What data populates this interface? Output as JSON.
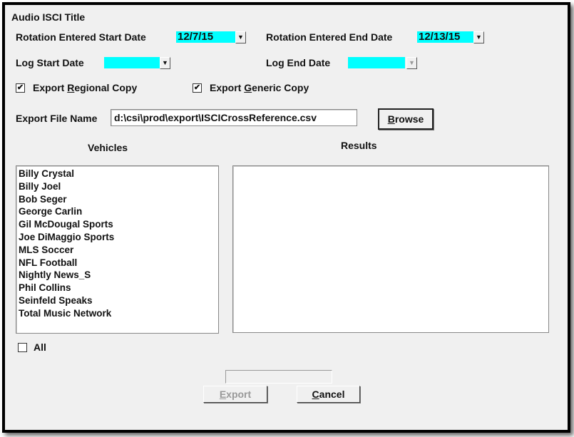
{
  "title": "Audio ISCI Title",
  "rotation_start": {
    "label": "Rotation Entered Start Date",
    "value": "12/7/15"
  },
  "rotation_end": {
    "label": "Rotation Entered End Date",
    "value": "12/13/15"
  },
  "log_start": {
    "label": "Log Start Date",
    "value": ""
  },
  "log_end": {
    "label": "Log End Date",
    "value": ""
  },
  "export_regional": {
    "pre": "Export ",
    "key": "R",
    "post": "egional Copy",
    "checked": true
  },
  "export_generic": {
    "pre": "Export ",
    "key": "G",
    "post": "eneric Copy",
    "checked": true
  },
  "export_file": {
    "label": "Export File Name",
    "value": "d:\\csi\\prod\\export\\ISCICrossReference.csv"
  },
  "browse": {
    "key": "B",
    "rest": "rowse"
  },
  "vehicles": {
    "header": "Vehicles",
    "items": [
      "Billy Crystal",
      "Billy Joel",
      "Bob Seger",
      "George Carlin",
      "Gil McDougal Sports",
      "Joe DiMaggio Sports",
      "MLS Soccer",
      "NFL Football",
      "Nightly News_S",
      "Phil Collins",
      "Seinfeld Speaks",
      "Total Music Network"
    ]
  },
  "results": {
    "header": "Results"
  },
  "all": {
    "label": "All",
    "checked": false
  },
  "progress": 0,
  "export_btn": {
    "key": "E",
    "rest": "xport",
    "disabled": true
  },
  "cancel_btn": {
    "key": "C",
    "rest": "ancel"
  },
  "colors": {
    "date_field": "#00ffff",
    "background": "#f0f0f0"
  }
}
